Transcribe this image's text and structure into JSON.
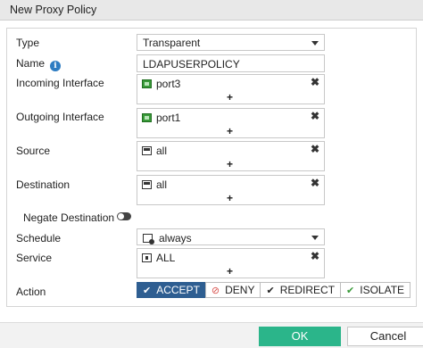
{
  "dialog": {
    "title": "New Proxy Policy"
  },
  "form": {
    "type": {
      "label": "Type",
      "value": "Transparent"
    },
    "name": {
      "label": "Name",
      "value": "LDAPUSERPOLICY"
    },
    "incoming_interface": {
      "label": "Incoming Interface",
      "entry": "port3",
      "icon": "port-icon"
    },
    "outgoing_interface": {
      "label": "Outgoing Interface",
      "entry": "port1",
      "icon": "port-icon"
    },
    "source": {
      "label": "Source",
      "entry": "all",
      "icon": "address-icon"
    },
    "destination": {
      "label": "Destination",
      "entry": "all",
      "icon": "address-icon"
    },
    "negate_destination": {
      "label": "Negate Destination",
      "enabled": false
    },
    "schedule": {
      "label": "Schedule",
      "value": "always",
      "icon": "schedule-icon"
    },
    "service": {
      "label": "Service",
      "entry": "ALL",
      "icon": "service-icon"
    },
    "action": {
      "label": "Action",
      "options": [
        "ACCEPT",
        "DENY",
        "REDIRECT",
        "ISOLATE"
      ],
      "selected": "ACCEPT"
    },
    "add_symbol": "+",
    "remove_symbol": "✖"
  },
  "footer": {
    "ok_label": "OK",
    "cancel_label": "Cancel"
  },
  "colors": {
    "accent": "#2e5e91",
    "ok": "#2bb58a",
    "port_icon": "#3a9a3a",
    "info": "#2d7cc2",
    "deny_icon": "#d9534f",
    "isolate_icon": "#3a9a3a"
  }
}
